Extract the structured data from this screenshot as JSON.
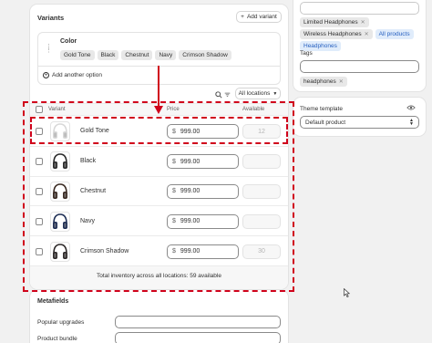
{
  "variants_card": {
    "title": "Variants",
    "add_variant_label": "Add variant",
    "option": {
      "name": "Color",
      "values": [
        "Gold Tone",
        "Black",
        "Chestnut",
        "Navy",
        "Crimson Shadow"
      ]
    },
    "add_another_option_label": "Add another option",
    "location_filter_label": "All locations",
    "columns": {
      "variant": "Variant",
      "price": "Price",
      "available": "Available"
    },
    "currency_symbol": "$",
    "rows": [
      {
        "name": "Gold Tone",
        "price": "999.00",
        "available": "12",
        "color": "#d8d8d8"
      },
      {
        "name": "Black",
        "price": "999.00",
        "available": "",
        "color": "#2a2a2a"
      },
      {
        "name": "Chestnut",
        "price": "999.00",
        "available": "",
        "color": "#3a2a22"
      },
      {
        "name": "Navy",
        "price": "999.00",
        "available": "",
        "color": "#1f2f55"
      },
      {
        "name": "Crimson Shadow",
        "price": "999.00",
        "available": "30",
        "color": "#2e2a2a"
      }
    ],
    "total_inventory": "Total inventory across all locations: 59 available"
  },
  "metafields": {
    "title": "Metafields",
    "fields": [
      {
        "label": "Popular upgrades",
        "value": ""
      },
      {
        "label": "Product bundle",
        "value": ""
      }
    ]
  },
  "organization": {
    "collections": [
      "Limited Headphones",
      "Wireless Headphones"
    ],
    "all_products_label": "All products",
    "collection_headphones": "Headphones",
    "tags_label": "Tags",
    "tags": [
      "headphones"
    ]
  },
  "theme_template": {
    "label": "Theme template",
    "value": "Default product"
  },
  "annotation": {
    "color": "#d0021b"
  }
}
